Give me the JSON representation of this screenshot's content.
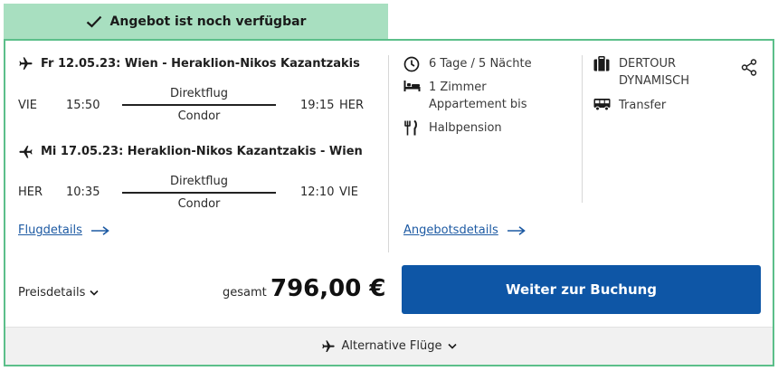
{
  "banner": {
    "text": "Angebot ist noch verfügbar",
    "icon": "check-icon"
  },
  "outbound": {
    "title": "Fr 12.05.23: Wien - Heraklion-Nikos Kazantzakis",
    "dep_code": "VIE",
    "dep_time": "15:50",
    "type": "Direktflug",
    "airline": "Condor",
    "arr_time": "19:15",
    "arr_code": "HER"
  },
  "inbound": {
    "title": "Mi 17.05.23: Heraklion-Nikos Kazantzakis - Wien",
    "dep_code": "HER",
    "dep_time": "10:35",
    "type": "Direktflug",
    "airline": "Condor",
    "arr_time": "12:10",
    "arr_code": "VIE"
  },
  "links": {
    "flight_details": "Flugdetails",
    "offer_details": "Angebotsdetails"
  },
  "features": {
    "duration": "6 Tage / 5 Nächte",
    "room": "1 Zimmer Appartement bis",
    "board": "Halbpension"
  },
  "operator": {
    "name": "DERTOUR DYNAMISCH",
    "transfer": "Transfer"
  },
  "price": {
    "details_label": "Preisdetails",
    "total_label": "gesamt",
    "amount": "796,00 €"
  },
  "book_button": "Weiter zur Buchung",
  "footer": {
    "alternative": "Alternative Flüge"
  },
  "colors": {
    "banner_bg": "#a8dfc0",
    "border": "#5cbf8a",
    "button": "#0e56a6",
    "link": "#1d5aa3"
  }
}
